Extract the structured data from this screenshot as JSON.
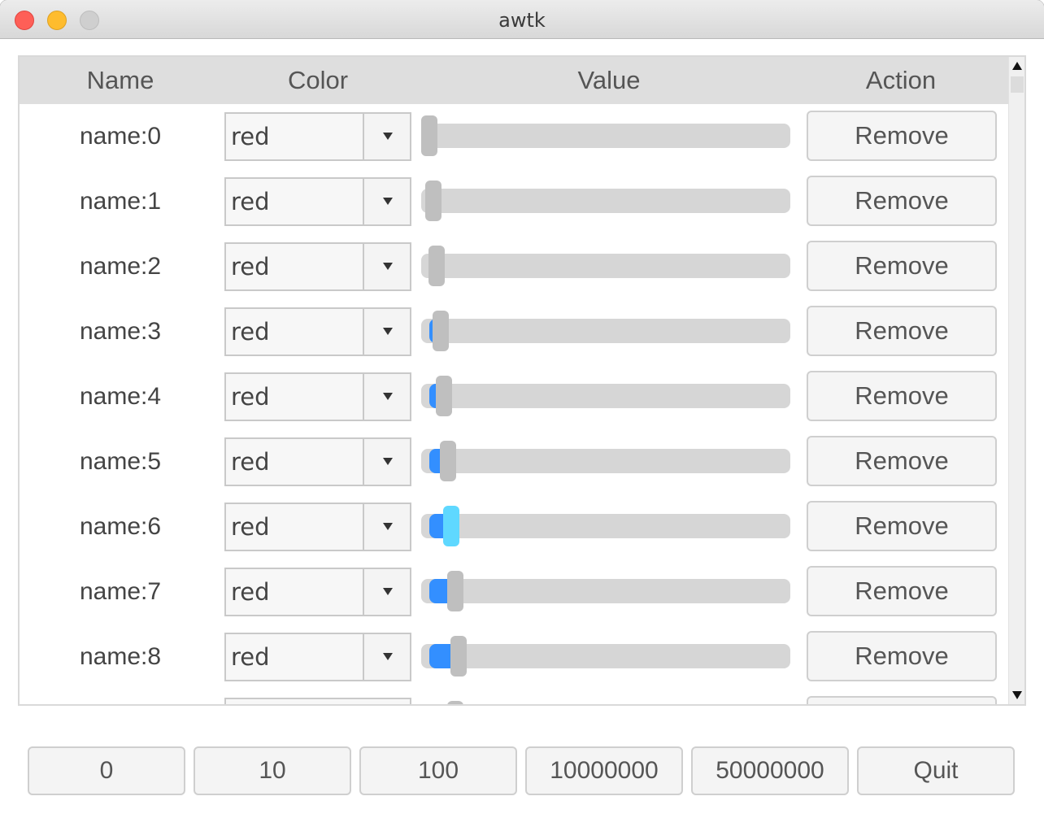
{
  "window": {
    "title": "awtk"
  },
  "grid": {
    "columns": [
      "Name",
      "Color",
      "Value",
      "Action"
    ],
    "rows": [
      {
        "name": "name:0",
        "color": "red",
        "value": 0,
        "action": "Remove"
      },
      {
        "name": "name:1",
        "color": "red",
        "value": 1,
        "action": "Remove"
      },
      {
        "name": "name:2",
        "color": "red",
        "value": 2,
        "action": "Remove"
      },
      {
        "name": "name:3",
        "color": "red",
        "value": 3,
        "action": "Remove"
      },
      {
        "name": "name:4",
        "color": "red",
        "value": 4,
        "action": "Remove"
      },
      {
        "name": "name:5",
        "color": "red",
        "value": 5,
        "action": "Remove"
      },
      {
        "name": "name:6",
        "color": "red",
        "value": 6,
        "action": "Remove",
        "active": true
      },
      {
        "name": "name:7",
        "color": "red",
        "value": 7,
        "action": "Remove"
      },
      {
        "name": "name:8",
        "color": "red",
        "value": 8,
        "action": "Remove"
      }
    ],
    "slider_max": 100
  },
  "buttons": [
    "0",
    "10",
    "100",
    "10000000",
    "50000000",
    "Quit"
  ],
  "colors": {
    "slider_fill": "#338fff",
    "slider_thumb_active": "#5fd8ff",
    "header_bg": "#dedede"
  }
}
